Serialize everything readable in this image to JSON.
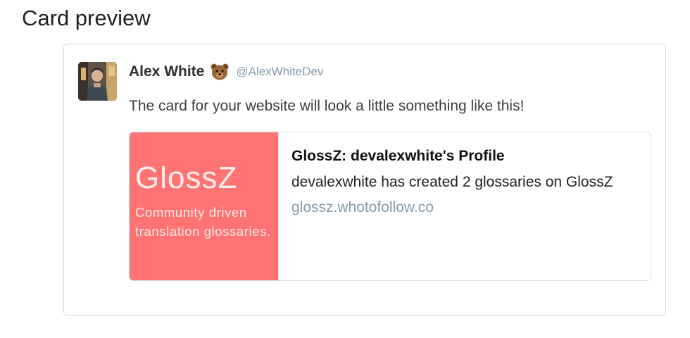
{
  "page": {
    "title": "Card preview"
  },
  "tweet": {
    "display_name": "Alex White",
    "emoji_icon": "bear-face-icon",
    "handle": "@AlexWhiteDev",
    "text": "The card for your website will look a little something like this!"
  },
  "card": {
    "image": {
      "logo_text": "GlossZ",
      "tagline": "Community driven translation glossaries.",
      "background_color": "#ff7373"
    },
    "title": "GlossZ: devalexwhite's Profile",
    "description": "devalexwhite has created 2 glossaries on GlossZ",
    "domain": "glossz.whotofollow.co"
  }
}
